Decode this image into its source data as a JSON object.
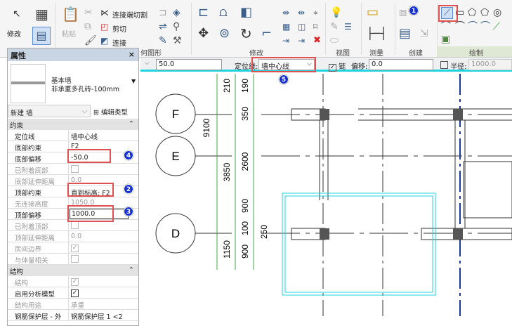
{
  "ribbon": {
    "modify_label": "修改",
    "paste_label": "粘贴",
    "join_cut_label": "连接端切割",
    "cut_label": "剪切",
    "join_label": "连接",
    "geometry_group": "何图形",
    "modify_group": "修改",
    "view_group": "视图",
    "measure_group": "测量",
    "create_group": "创建",
    "draw_group": "绘制"
  },
  "options_bar": {
    "height_value": "50.0",
    "location_line_label": "定位线:",
    "location_line_value": "墙中心线",
    "chain_label": "链",
    "chain_checked": true,
    "offset_label": "偏移:",
    "offset_value": "0.0",
    "radius_label": "半径:",
    "radius_checked": false,
    "radius_value": "1000.0"
  },
  "properties": {
    "title": "属性",
    "close": "×",
    "family": "基本墙",
    "type": "非承重多孔砖-100mm",
    "instance_selector": "新建 墙",
    "edit_type": "编辑类型",
    "sections": [
      {
        "label": "约束"
      },
      {
        "label": "结构"
      }
    ],
    "rows": [
      {
        "key": "定位线",
        "value": "墙中心线"
      },
      {
        "key": "底部约束",
        "value": "F2"
      },
      {
        "key": "底部偏移",
        "value": "-50.0"
      },
      {
        "key": "已附着底部",
        "value": ""
      },
      {
        "key": "底部延伸距离",
        "value": "0.0"
      },
      {
        "key": "顶部约束",
        "value": "直到标高: F2"
      },
      {
        "key": "无连接高度",
        "value": "1050.0"
      },
      {
        "key": "顶部偏移",
        "value": "1000.0"
      },
      {
        "key": "已附着顶部",
        "value": ""
      },
      {
        "key": "顶部延伸距离",
        "value": "0.0"
      },
      {
        "key": "房间边界",
        "value": "✓"
      },
      {
        "key": "与体量相关",
        "value": ""
      },
      {
        "key": "结构",
        "value": "✓"
      },
      {
        "key": "启用分析模型",
        "value": "✓"
      },
      {
        "key": "结构用途",
        "value": "承重"
      },
      {
        "key": "钢筋保护层 - 外",
        "value": "钢筋保护层 1 <2"
      }
    ]
  },
  "badges": [
    "1",
    "2",
    "3",
    "4",
    "5"
  ],
  "drawing": {
    "grids": [
      "F",
      "E",
      "D"
    ],
    "dims": [
      "210",
      "190",
      "350",
      "9100",
      "3850",
      "2600",
      "900",
      "100",
      "250",
      "1150",
      "900"
    ]
  },
  "colors": {
    "highlight": "#e05050",
    "badge": "#1530d0",
    "dim": "#3aa84a",
    "cyan": "#22d3e0"
  }
}
